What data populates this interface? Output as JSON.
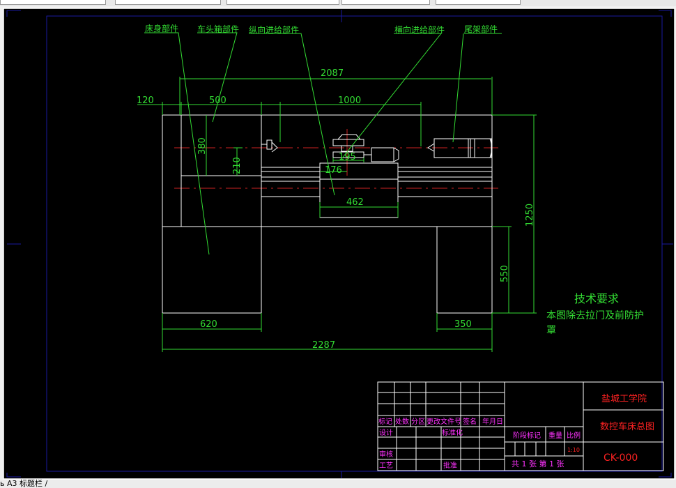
{
  "colors": {
    "background": "#000000",
    "geometry": "#ffffff",
    "dimension": "#33dd33",
    "centerline": "#cc2222",
    "frame": "#1a1aa0",
    "titleblock_label": "#ff33ff",
    "titleblock_title": "#ff2222"
  },
  "bottom_tab": {
    "label": "ь A3 标题栏 /"
  },
  "labels": {
    "bed": "床身部件",
    "headstock": "车头箱部件",
    "longitudinal_feed": "纵向进给部件",
    "cross_feed": "横向进给部件",
    "tailstock": "尾架部件"
  },
  "dimensions": {
    "d2087": "2087",
    "d120": "120",
    "d500": "500",
    "d1000": "1000",
    "d380": "380",
    "d210": "210",
    "d195": "195",
    "d176": "176",
    "d462": "462",
    "d1250": "1250",
    "d550": "550",
    "d620": "620",
    "d350": "350",
    "d2287": "2287"
  },
  "notes": {
    "title": "技术要求",
    "line1": "本图除去拉门及前防护",
    "line2": "罩"
  },
  "title_block": {
    "headers": [
      "标记",
      "处数",
      "分区",
      "更改文件号",
      "签名",
      "年月日"
    ],
    "design": "设计",
    "standardization": "标准化",
    "review": "审核",
    "process": "工艺",
    "approve": "批准",
    "stage_mark": "阶段标记",
    "weight": "重量",
    "scale_label": "比例",
    "scale_value": "1:10",
    "sheets": "共 1 张 第 1 张",
    "school": "盐城工学院",
    "drawing_name": "数控车床总图",
    "drawing_number": "CK-000"
  }
}
